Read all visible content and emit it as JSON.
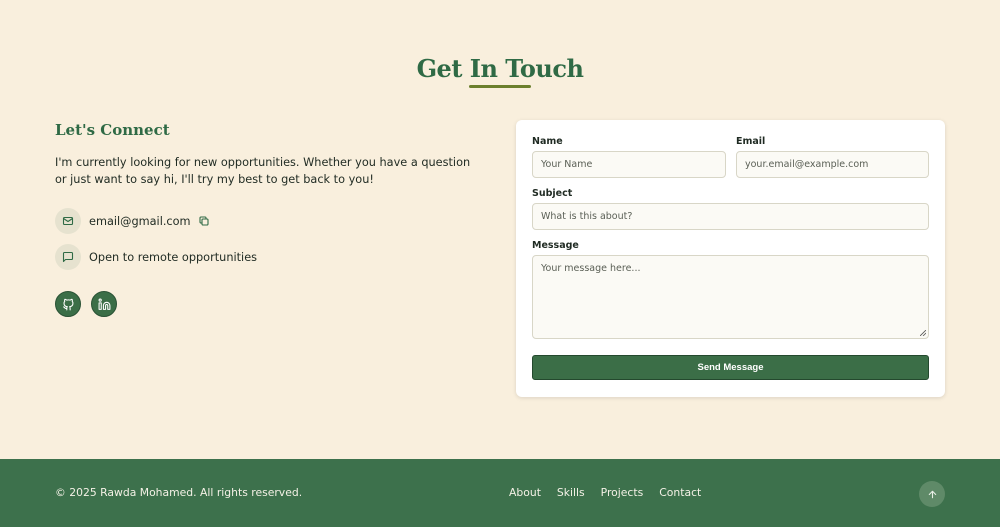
{
  "section": {
    "title": "Get In Touch"
  },
  "connect": {
    "heading": "Let's Connect",
    "text": "I'm currently looking for new opportunities. Whether you have a question or just want to say hi, I'll try my best to get back to you!",
    "email": "email@gmail.com",
    "remote": "Open to remote opportunities",
    "icons": {
      "email": "mail-icon",
      "copy": "copy-icon",
      "remote": "message-square-icon",
      "github": "github-icon",
      "linkedin": "linkedin-icon"
    }
  },
  "form": {
    "name": {
      "label": "Name",
      "placeholder": "Your Name"
    },
    "email": {
      "label": "Email",
      "placeholder": "your.email@example.com"
    },
    "subject": {
      "label": "Subject",
      "placeholder": "What is this about?"
    },
    "message": {
      "label": "Message",
      "placeholder": "Your message here..."
    },
    "submit": "Send Message"
  },
  "footer": {
    "copyright": "© 2025 Rawda Mohamed. All rights reserved.",
    "links": [
      "About",
      "Skills",
      "Projects",
      "Contact"
    ],
    "to_top_icon": "arrow-up-icon"
  },
  "colors": {
    "background": "#f9efdd",
    "accent": "#2f6a45",
    "button": "#3b6e47",
    "footer": "#3d714c",
    "underline": "#6c7f2d"
  }
}
